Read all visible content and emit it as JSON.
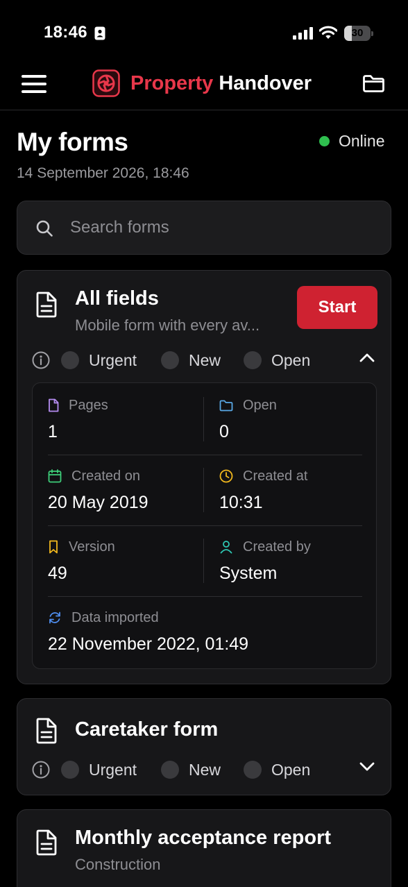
{
  "status_bar": {
    "time": "18:46",
    "battery": "30",
    "battery_level": 0.3
  },
  "header": {
    "brand_primary": "Property",
    "brand_secondary": "Handover"
  },
  "page": {
    "title": "My forms",
    "connection": "Online",
    "datetime": "14 September 2026, 18:46"
  },
  "search": {
    "placeholder": "Search forms"
  },
  "forms": [
    {
      "title": "All fields",
      "subtitle": "Mobile form with every av...",
      "start_label": "Start",
      "statuses": [
        "Urgent",
        "New",
        "Open"
      ],
      "expanded": true,
      "details": {
        "pages_label": "Pages",
        "pages": "1",
        "open_label": "Open",
        "open": "0",
        "created_on_label": "Created on",
        "created_on": "20 May 2019",
        "created_at_label": "Created at",
        "created_at": "10:31",
        "version_label": "Version",
        "version": "49",
        "created_by_label": "Created by",
        "created_by": "System",
        "imported_label": "Data imported",
        "imported": "22 November 2022, 01:49"
      }
    },
    {
      "title": "Caretaker form",
      "statuses": [
        "Urgent",
        "New",
        "Open"
      ],
      "expanded": false
    },
    {
      "title": "Monthly acceptance report",
      "subtitle": "Construction"
    }
  ],
  "colors": {
    "accent": "#cf2231",
    "brand_red": "#e8374a",
    "online": "#2fbf4f",
    "background": "#000000",
    "card": "#171719"
  },
  "icons": {
    "menu": "hamburger-icon",
    "folder": "folder-icon",
    "search": "search-icon",
    "form": "document-icon",
    "info": "info-icon",
    "collapse": "chevron-up-icon",
    "expand": "chevron-down-icon"
  }
}
